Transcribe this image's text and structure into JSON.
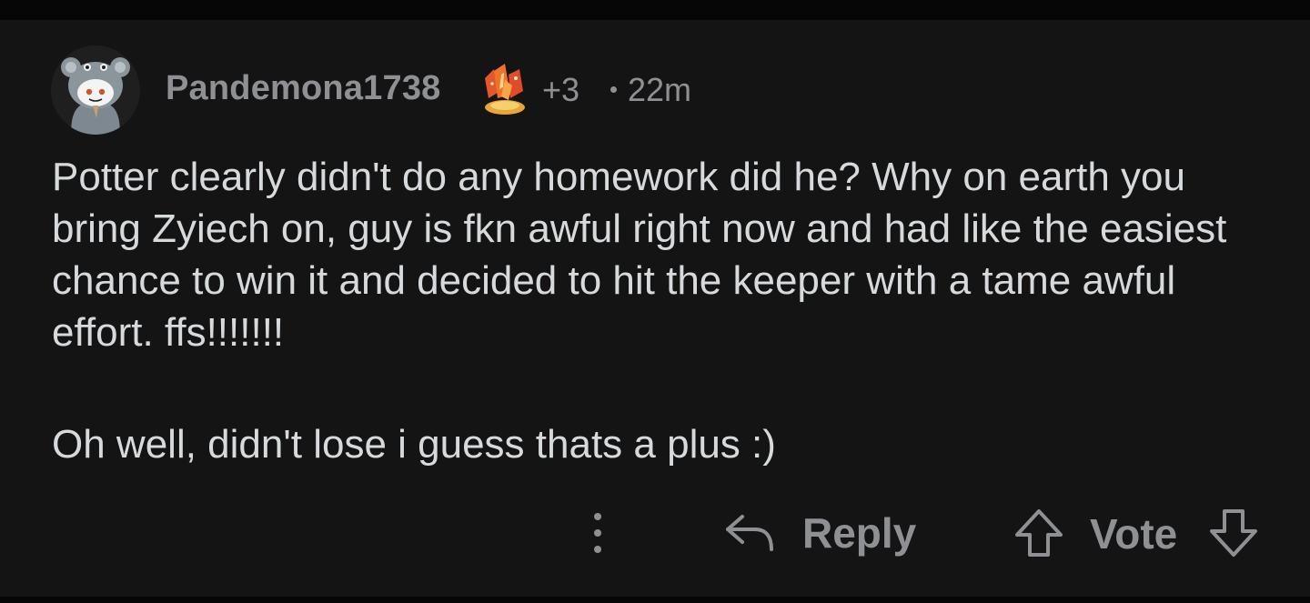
{
  "comment": {
    "author": "Pandemona1738",
    "award_count": "+3",
    "timestamp": "22m",
    "avatar": {
      "icon": "snoo-avatar-icon"
    },
    "award": {
      "icon": "gem-award-icon"
    },
    "body": [
      "Potter clearly didn't do any homework did he? Why on earth you bring Zyiech on, guy is fkn awful right now and had like the easiest chance to win it and decided to hit the keeper with a tame awful effort. ffs!!!!!!!",
      "Oh well, didn't lose i guess thats a plus :)"
    ]
  },
  "actions": {
    "more_icon": "more-vertical-icon",
    "reply_icon": "reply-arrow-icon",
    "reply_label": "Reply",
    "upvote_icon": "upvote-arrow-icon",
    "vote_label": "Vote",
    "downvote_icon": "downvote-arrow-icon"
  },
  "colors": {
    "background": "#141414",
    "text_primary": "#d7dadc",
    "text_muted": "#8e9094",
    "award_orange": "#f0722a",
    "award_gold": "#f5b63a"
  }
}
